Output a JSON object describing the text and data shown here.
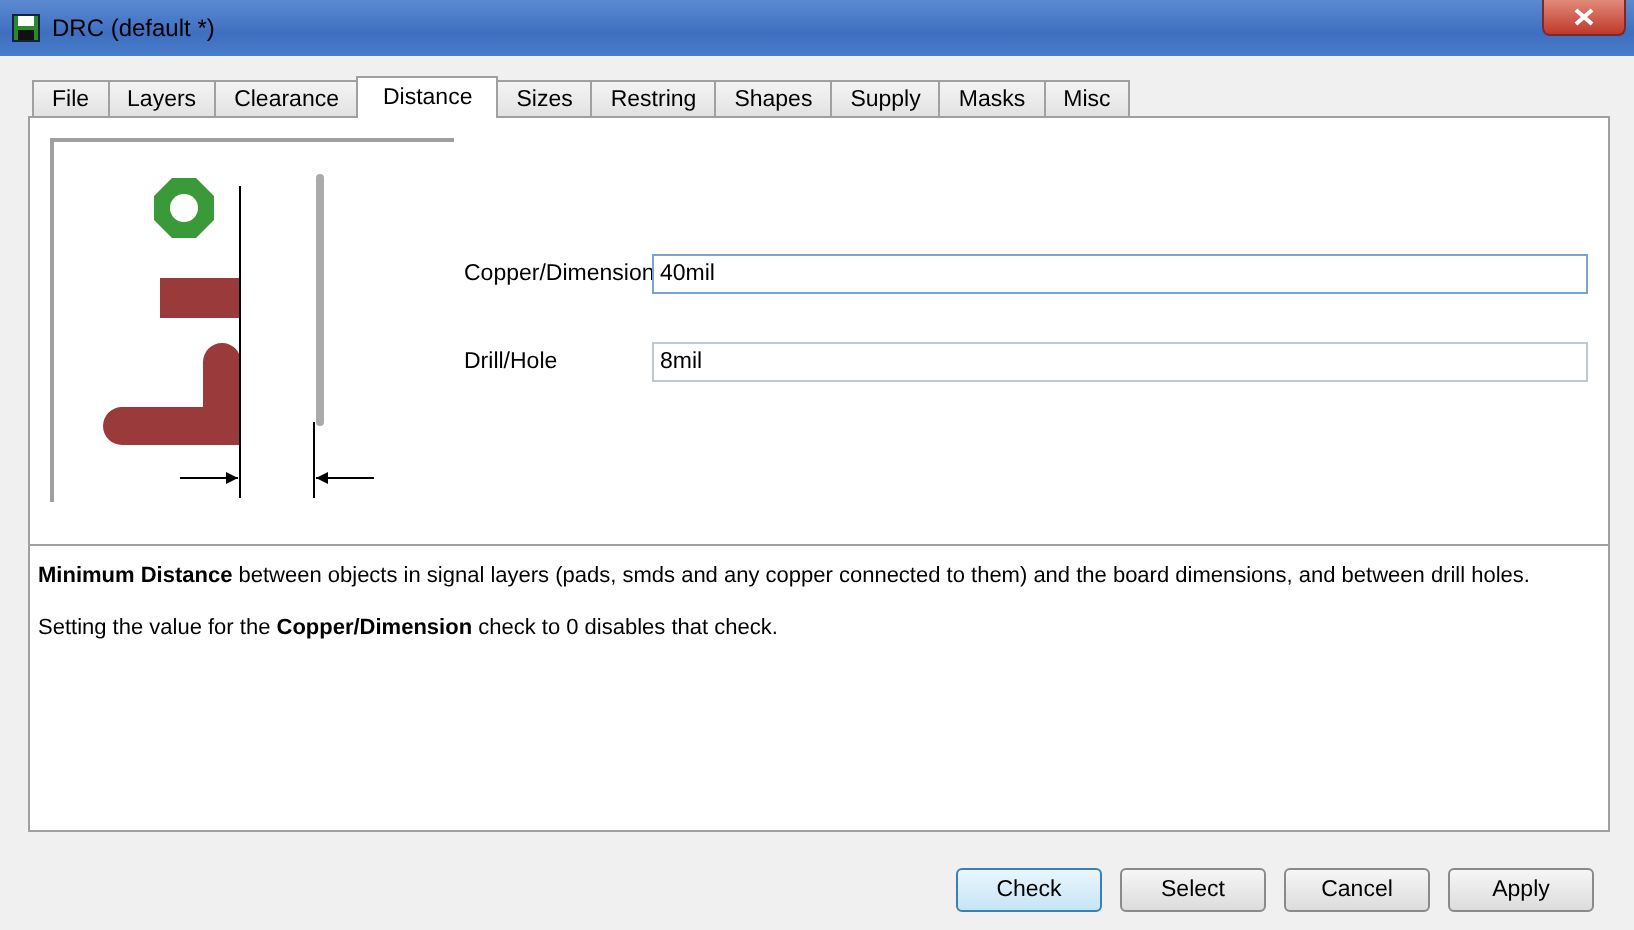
{
  "window": {
    "title": "DRC (default *)"
  },
  "tabs": [
    {
      "label": "File",
      "selected": false
    },
    {
      "label": "Layers",
      "selected": false
    },
    {
      "label": "Clearance",
      "selected": false
    },
    {
      "label": "Distance",
      "selected": true
    },
    {
      "label": "Sizes",
      "selected": false
    },
    {
      "label": "Restring",
      "selected": false
    },
    {
      "label": "Shapes",
      "selected": false
    },
    {
      "label": "Supply",
      "selected": false
    },
    {
      "label": "Masks",
      "selected": false
    },
    {
      "label": "Misc",
      "selected": false
    }
  ],
  "fields": [
    {
      "label": "Copper/Dimension",
      "value": "40mil",
      "focused": true
    },
    {
      "label": "Drill/Hole",
      "value": "8mil",
      "focused": false
    }
  ],
  "description": [
    "**Minimum Distance** between objects in signal layers (pads, smds and any copper connected to them) and the board dimensions, and between drill holes.",
    "Setting the value for the **Copper/Dimension** check to 0 disables that check."
  ],
  "buttons": [
    {
      "label": "Check",
      "default": true
    },
    {
      "label": "Select",
      "default": false
    },
    {
      "label": "Cancel",
      "default": false
    },
    {
      "label": "Apply",
      "default": false
    }
  ]
}
